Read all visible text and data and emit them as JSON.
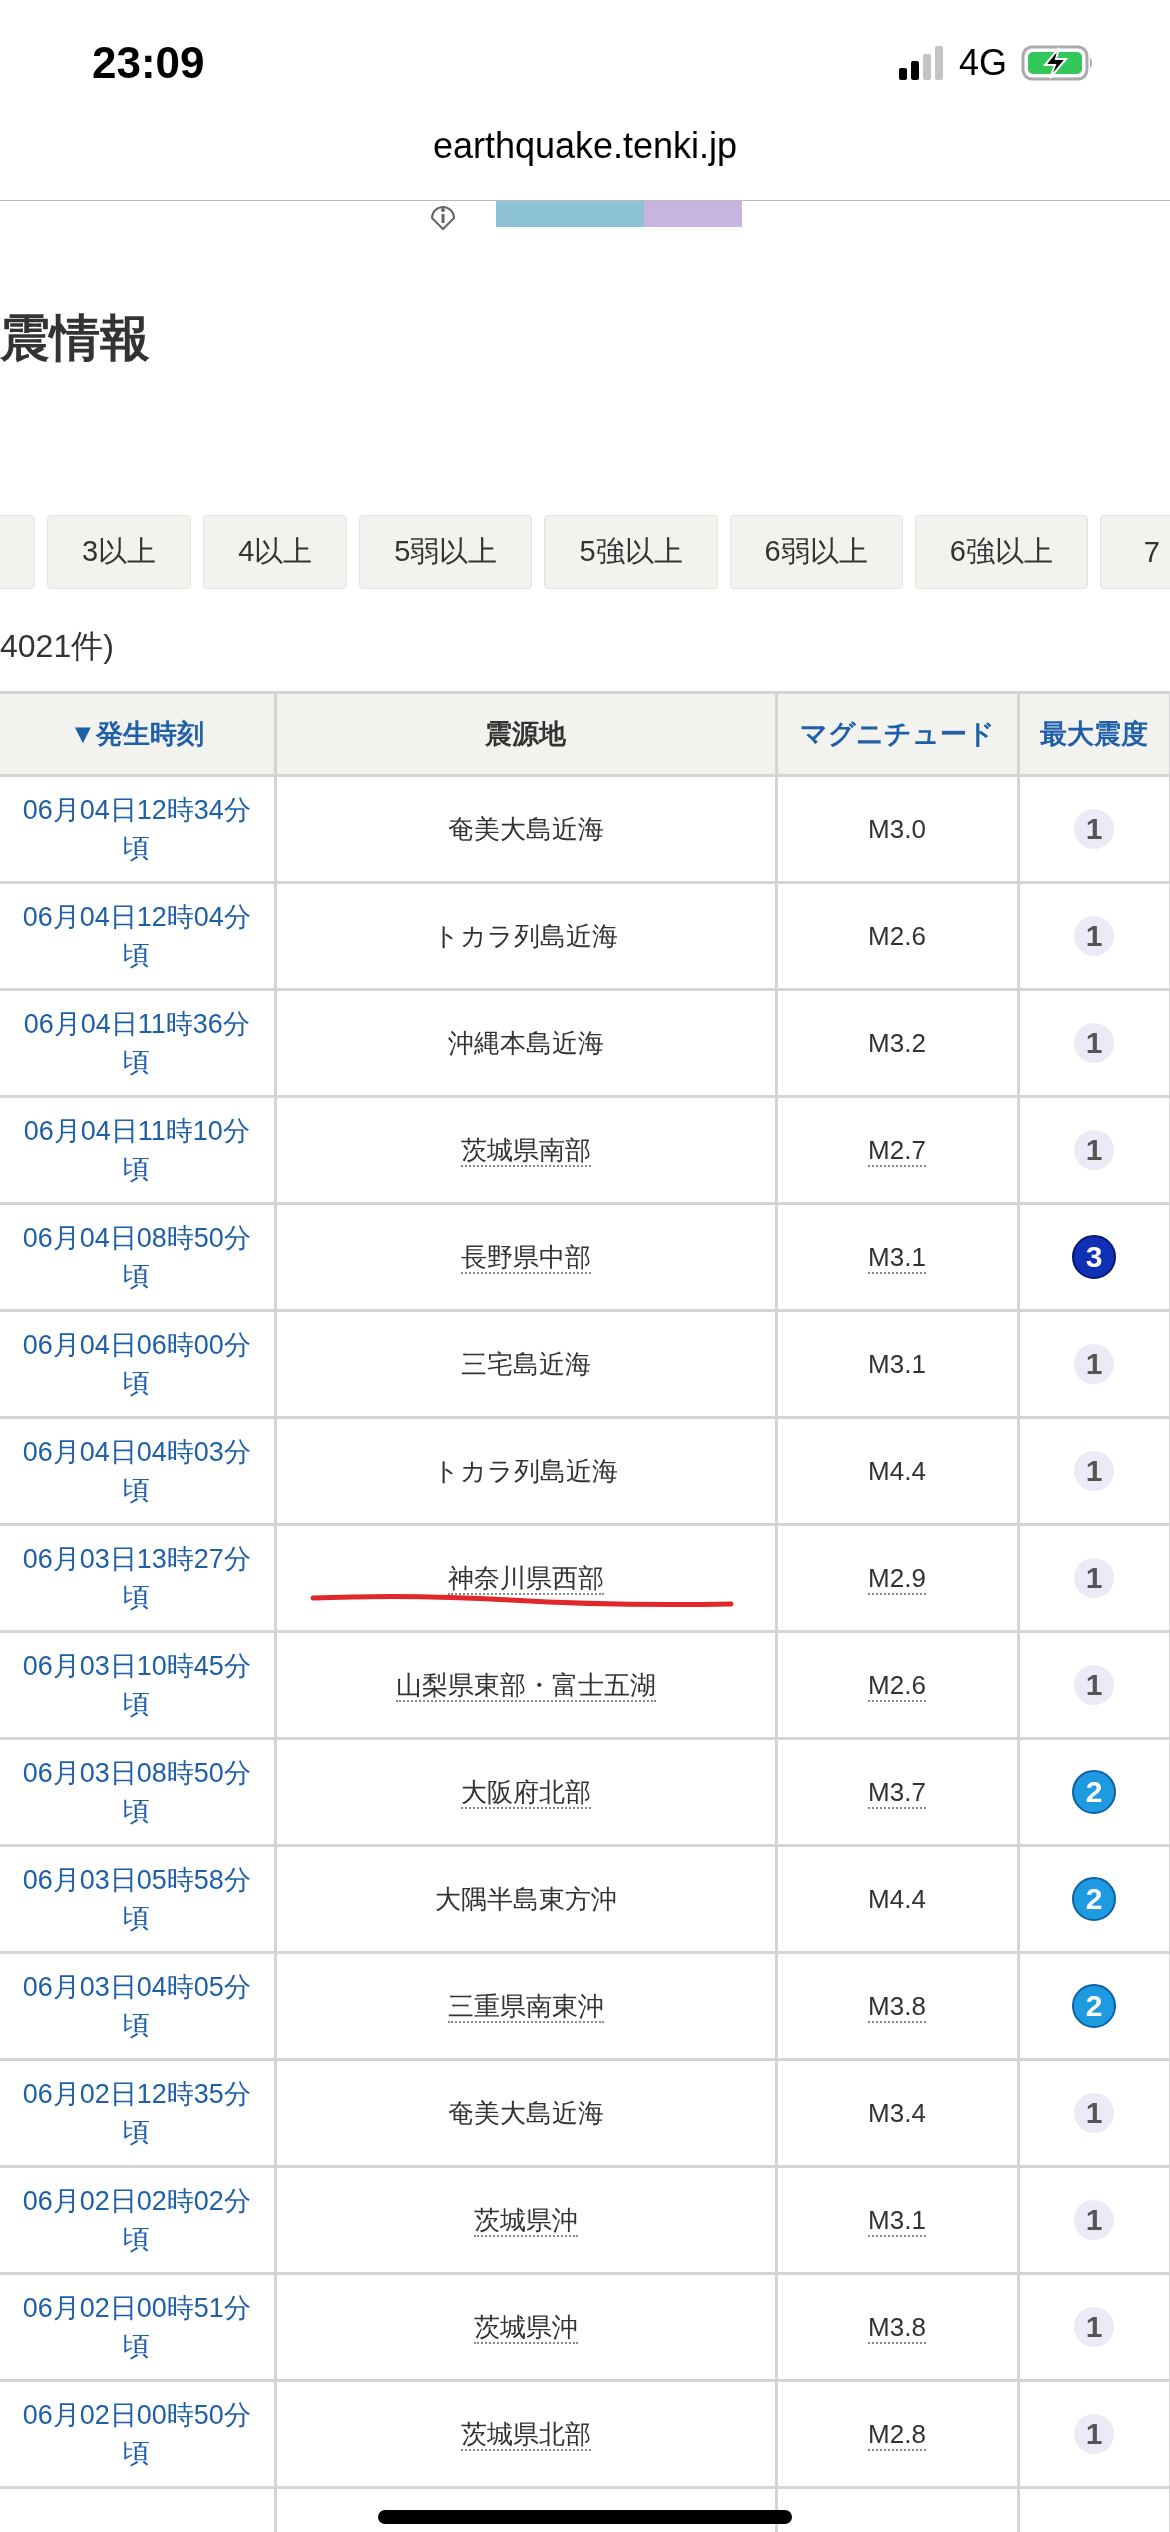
{
  "status_bar": {
    "time": "23:09",
    "network": "4G"
  },
  "browser": {
    "url": "earthquake.tenki.jp"
  },
  "heading": "震情報",
  "filters": [
    {
      "selected": false
    },
    {
      "label": "3以上",
      "selected": false
    },
    {
      "label": "4以上",
      "selected": false
    },
    {
      "label": "5弱以上",
      "selected": false
    },
    {
      "label": "5強以上",
      "selected": false
    },
    {
      "label": "6弱以上",
      "selected": false
    },
    {
      "label": "6強以上",
      "selected": false
    },
    {
      "label": "7",
      "selected": false
    }
  ],
  "count": "4021件)",
  "table": {
    "columns": [
      "▼発生時刻",
      "震源地",
      "マグニチュード",
      "最大震度"
    ],
    "rows": [
      {
        "time": "06月04日12時34分頃",
        "place": "奄美大島近海",
        "magnitude": "M3.0",
        "intensity": "1",
        "linked": false,
        "marked": false
      },
      {
        "time": "06月04日12時04分頃",
        "place": "トカラ列島近海",
        "magnitude": "M2.6",
        "intensity": "1",
        "linked": false,
        "marked": false
      },
      {
        "time": "06月04日11時36分頃",
        "place": "沖縄本島近海",
        "magnitude": "M3.2",
        "intensity": "1",
        "linked": false,
        "marked": false
      },
      {
        "time": "06月04日11時10分頃",
        "place": "茨城県南部",
        "magnitude": "M2.7",
        "intensity": "1",
        "linked": true,
        "marked": false
      },
      {
        "time": "06月04日08時50分頃",
        "place": "長野県中部",
        "magnitude": "M3.1",
        "intensity": "3",
        "linked": true,
        "marked": false
      },
      {
        "time": "06月04日06時00分頃",
        "place": "三宅島近海",
        "magnitude": "M3.1",
        "intensity": "1",
        "linked": false,
        "marked": false
      },
      {
        "time": "06月04日04時03分頃",
        "place": "トカラ列島近海",
        "magnitude": "M4.4",
        "intensity": "1",
        "linked": false,
        "marked": false
      },
      {
        "time": "06月03日13時27分頃",
        "place": "神奈川県西部",
        "magnitude": "M2.9",
        "intensity": "1",
        "linked": true,
        "marked": true
      },
      {
        "time": "06月03日10時45分頃",
        "place": "山梨県東部・富士五湖",
        "magnitude": "M2.6",
        "intensity": "1",
        "linked": true,
        "marked": false
      },
      {
        "time": "06月03日08時50分頃",
        "place": "大阪府北部",
        "magnitude": "M3.7",
        "intensity": "2",
        "linked": true,
        "marked": false
      },
      {
        "time": "06月03日05時58分頃",
        "place": "大隅半島東方沖",
        "magnitude": "M4.4",
        "intensity": "2",
        "linked": false,
        "marked": false
      },
      {
        "time": "06月03日04時05分頃",
        "place": "三重県南東沖",
        "magnitude": "M3.8",
        "intensity": "2",
        "linked": true,
        "marked": false
      },
      {
        "time": "06月02日12時35分頃",
        "place": "奄美大島近海",
        "magnitude": "M3.4",
        "intensity": "1",
        "linked": false,
        "marked": false
      },
      {
        "time": "06月02日02時02分頃",
        "place": "茨城県沖",
        "magnitude": "M3.1",
        "intensity": "1",
        "linked": true,
        "marked": false
      },
      {
        "time": "06月02日00時51分頃",
        "place": "茨城県沖",
        "magnitude": "M3.8",
        "intensity": "1",
        "linked": true,
        "marked": false
      },
      {
        "time": "06月02日00時50分頃",
        "place": "茨城県北部",
        "magnitude": "M2.8",
        "intensity": "1",
        "linked": true,
        "marked": false
      }
    ]
  }
}
